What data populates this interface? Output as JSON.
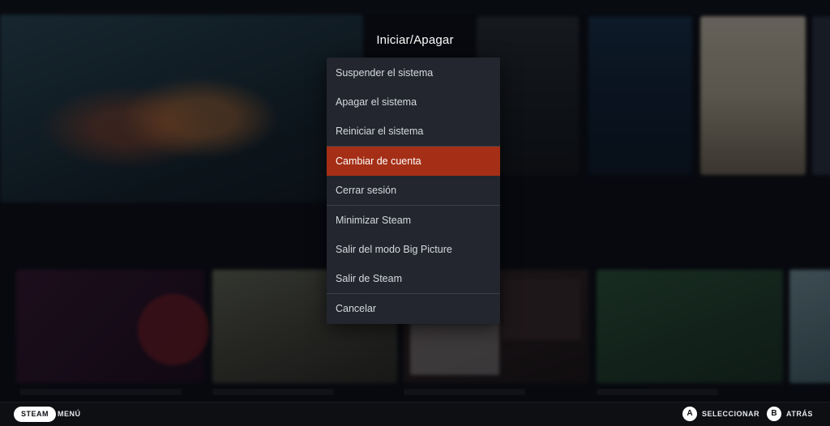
{
  "dialog": {
    "title": "Iniciar/Apagar",
    "items": [
      {
        "label": "Suspender el sistema"
      },
      {
        "label": "Apagar el sistema"
      },
      {
        "label": "Reiniciar el sistema"
      },
      {
        "label": "Cambiar de cuenta",
        "selected": true
      },
      {
        "label": "Cerrar sesión"
      },
      {
        "label": "Minimizar Steam"
      },
      {
        "label": "Salir del modo Big Picture"
      },
      {
        "label": "Salir de Steam"
      },
      {
        "label": "Cancelar"
      }
    ]
  },
  "footer": {
    "steam_button": "STEAM",
    "menu_label": "MENÚ",
    "a_glyph": "A",
    "select_label": "SELECCIONAR",
    "b_glyph": "B",
    "back_label": "ATRÁS"
  },
  "colors": {
    "selected_item": "#a42f16",
    "menu_background": "#23262e"
  }
}
